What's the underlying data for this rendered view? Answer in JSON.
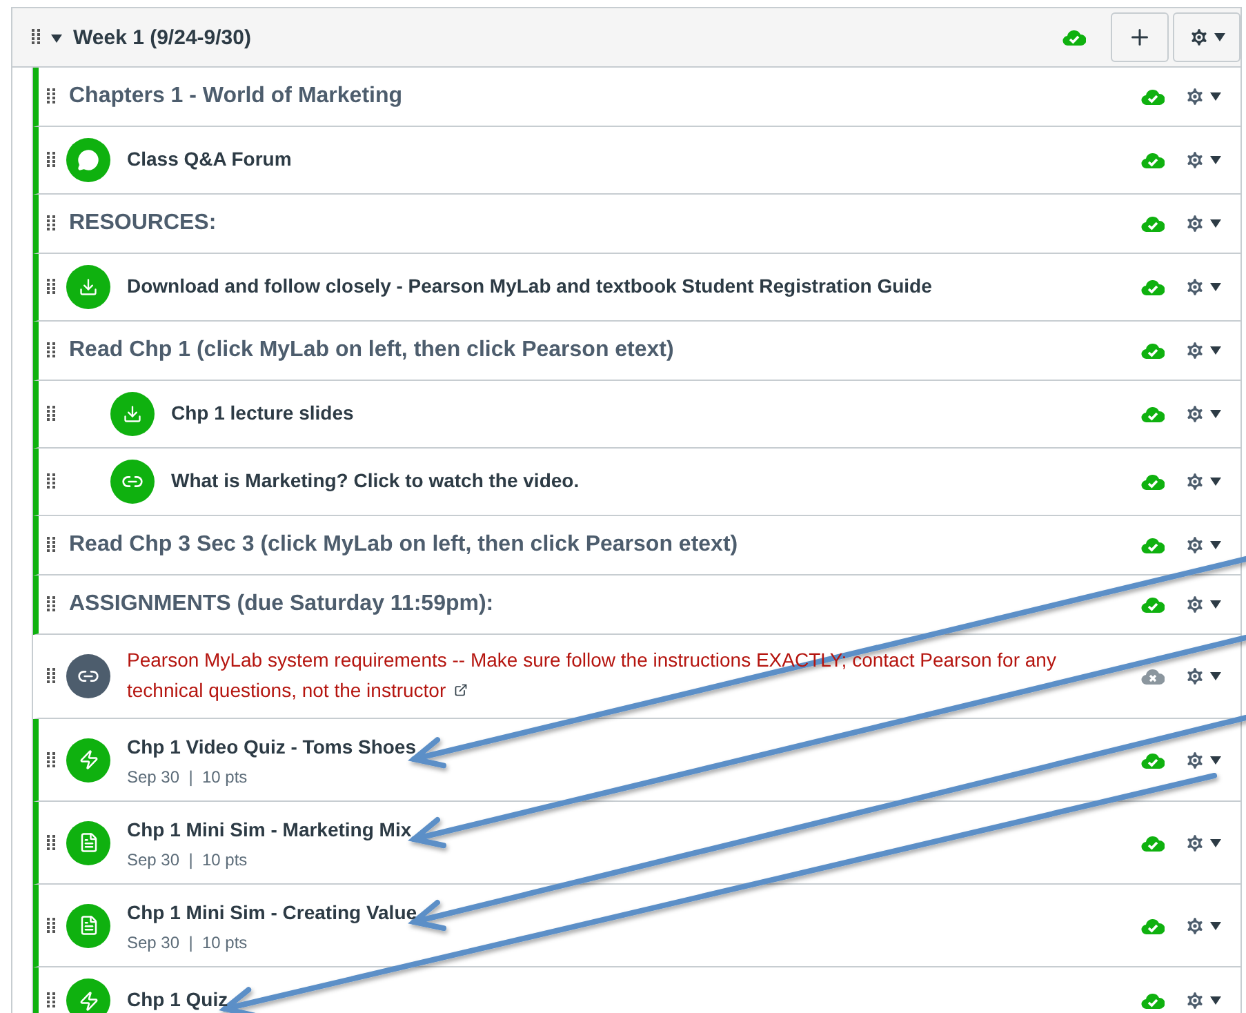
{
  "module": {
    "title": "Week 1 (9/24-9/30)",
    "expanded": true,
    "published": true
  },
  "items": [
    {
      "kind": "header",
      "title": "Chapters 1 - World of Marketing",
      "published": true
    },
    {
      "kind": "discussion",
      "title": "Class Q&A Forum",
      "published": true
    },
    {
      "kind": "header",
      "title": "RESOURCES:",
      "published": true
    },
    {
      "kind": "file",
      "title": "Download and follow closely - Pearson MyLab and textbook Student Registration Guide",
      "published": true
    },
    {
      "kind": "header",
      "title": "Read Chp 1 (click MyLab on left, then click Pearson etext)",
      "published": true,
      "children": [
        {
          "kind": "file",
          "title": "Chp 1 lecture slides",
          "published": true
        },
        {
          "kind": "link",
          "title": "What is Marketing? Click to watch the video.",
          "published": true
        }
      ]
    },
    {
      "kind": "header",
      "title": "Read Chp 3 Sec 3 (click MyLab on left, then click Pearson etext)",
      "published": true
    },
    {
      "kind": "header",
      "title": "ASSIGNMENTS (due Saturday 11:59pm):",
      "published": true
    },
    {
      "kind": "external",
      "title": "Pearson MyLab system requirements -- Make sure follow the instructions EXACTLY; contact Pearson for any technical questions, not the instructor",
      "published": false
    },
    {
      "kind": "quiz",
      "title": "Chp 1 Video Quiz - Toms Shoes",
      "meta": "Sep 30  |  10 pts",
      "published": true
    },
    {
      "kind": "assignment",
      "title": "Chp 1 Mini Sim - Marketing Mix",
      "meta": "Sep 30  |  10 pts",
      "published": true
    },
    {
      "kind": "assignment",
      "title": "Chp 1 Mini Sim - Creating Value",
      "meta": "Sep 30  |  10 pts",
      "published": true
    },
    {
      "kind": "quiz",
      "title": "Chp 1 Quiz",
      "published": true
    }
  ]
}
